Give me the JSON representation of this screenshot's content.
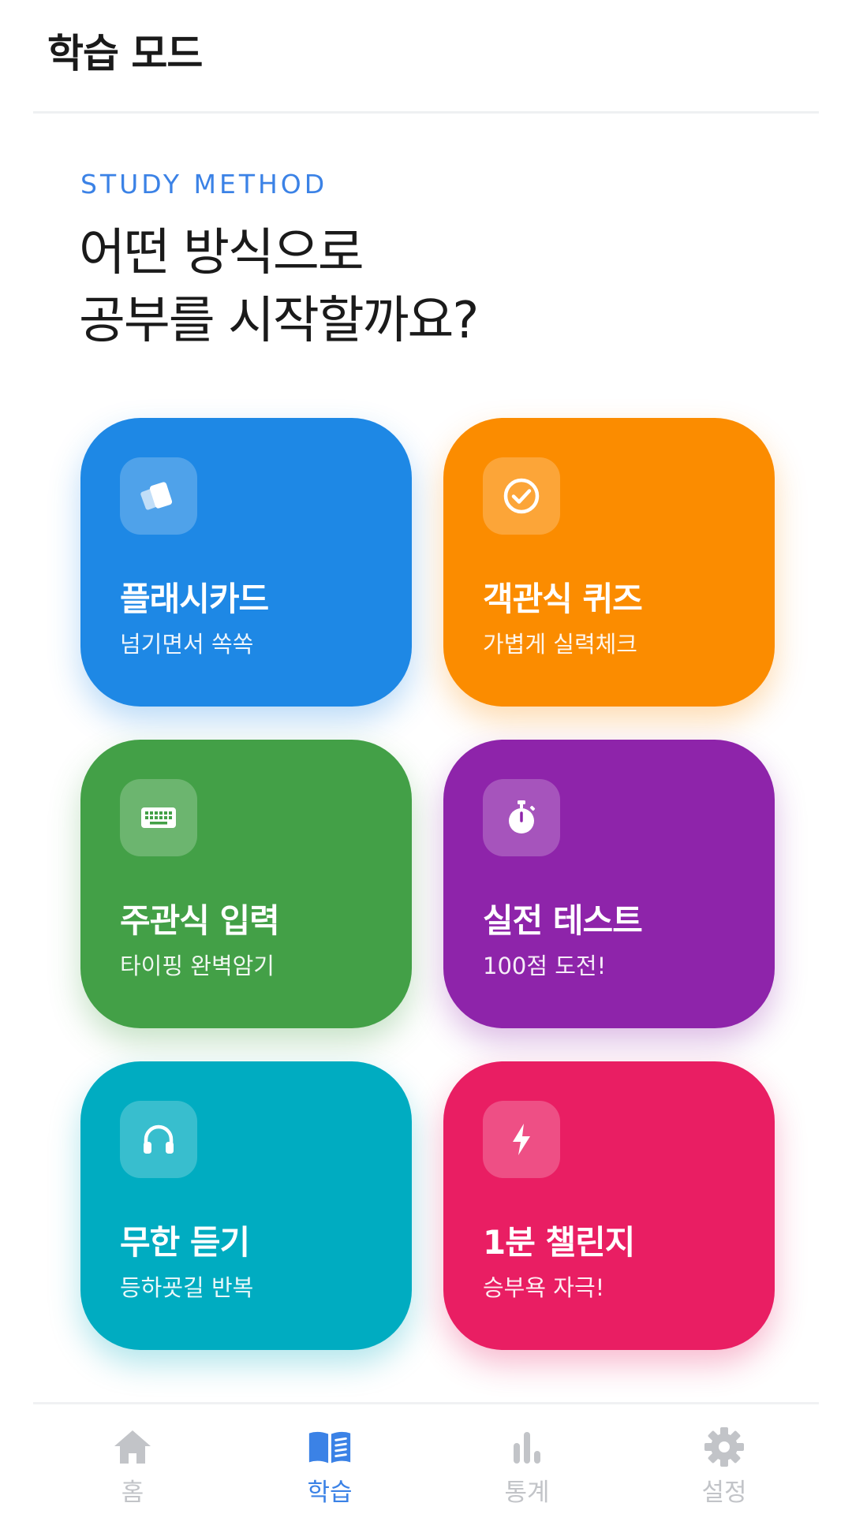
{
  "header": {
    "title": "학습 모드"
  },
  "intro": {
    "eyebrow": "STUDY METHOD",
    "headline_line1": "어떤 방식으로",
    "headline_line2": "공부를 시작할까요?"
  },
  "modes": [
    {
      "title": "플래시카드",
      "subtitle": "넘기면서 쏙쏙",
      "icon": "flashcards-icon",
      "color": "#1e88e5"
    },
    {
      "title": "객관식 퀴즈",
      "subtitle": "가볍게 실력체크",
      "icon": "check-circle-icon",
      "color": "#fb8c00"
    },
    {
      "title": "주관식 입력",
      "subtitle": "타이핑 완벽암기",
      "icon": "keyboard-icon",
      "color": "#43a047"
    },
    {
      "title": "실전 테스트",
      "subtitle": "100점 도전!",
      "icon": "stopwatch-icon",
      "color": "#8e24aa"
    },
    {
      "title": "무한 듣기",
      "subtitle": "등하굣길 반복",
      "icon": "headphones-icon",
      "color": "#00acc1"
    },
    {
      "title": "1분 챌린지",
      "subtitle": "승부욕 자극!",
      "icon": "lightning-icon",
      "color": "#e91e63"
    }
  ],
  "tabs": [
    {
      "label": "홈",
      "icon": "home-icon",
      "active": false
    },
    {
      "label": "학습",
      "icon": "book-icon",
      "active": true
    },
    {
      "label": "통계",
      "icon": "bar-chart-icon",
      "active": false
    },
    {
      "label": "설정",
      "icon": "gear-icon",
      "active": false
    }
  ],
  "colors": {
    "accent": "#3b82e6",
    "inactive": "#c2c4c8"
  }
}
